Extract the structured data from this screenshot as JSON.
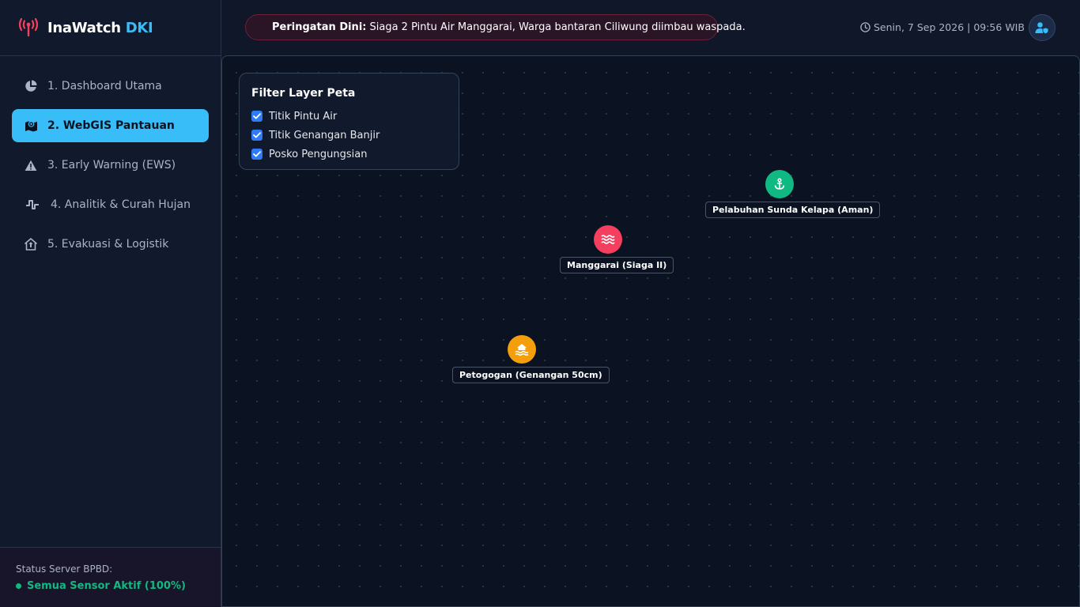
{
  "brand": {
    "name": "InaWatch",
    "accent": "DKI"
  },
  "nav": {
    "items": [
      {
        "label": "1. Dashboard Utama",
        "icon": "pie-chart-icon"
      },
      {
        "label": "2. WebGIS Pantauan",
        "icon": "map-icon",
        "active": true
      },
      {
        "label": "3. Early Warning (EWS)",
        "icon": "warning-icon"
      },
      {
        "label": "4. Analitik & Curah Hujan",
        "icon": "pulse-icon"
      },
      {
        "label": "5. Evakuasi & Logistik",
        "icon": "shelter-icon"
      }
    ]
  },
  "status": {
    "label": "Status Server BPBD:",
    "value": "Semua Sensor Aktif (100%)"
  },
  "alert": {
    "title": "Peringatan Dini:",
    "message": "Siaga 2 Pintu Air Manggarai, Warga bantaran Ciliwung diimbau waspada."
  },
  "header": {
    "datetime": "Senin, 7 Sep 2026 | 09:56 WIB"
  },
  "filter": {
    "title": "Filter Layer Peta",
    "layers": [
      {
        "label": "Titik Pintu Air",
        "checked": true
      },
      {
        "label": "Titik Genangan Banjir",
        "checked": true
      },
      {
        "label": "Posko Pengungsian",
        "checked": true
      }
    ]
  },
  "markers": [
    {
      "label": "Pelabuhan Sunda Kelapa (Aman)",
      "icon": "anchor-icon",
      "color": "#10b981"
    },
    {
      "label": "Manggarai (Siaga II)",
      "icon": "water-icon",
      "color": "#f43f5e"
    },
    {
      "label": "Petogogan (Genangan 50cm)",
      "icon": "flood-icon",
      "color": "#f59e0b"
    }
  ],
  "colors": {
    "accent": "#38bdf8",
    "danger": "#f43f5e",
    "success": "#10b981",
    "warning": "#f59e0b",
    "checkbox": "#2f7cf6"
  }
}
